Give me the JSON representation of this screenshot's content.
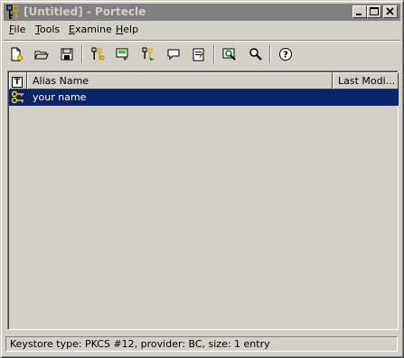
{
  "window": {
    "title": "[Untitled] - Portecle",
    "minimize_icon": "minimize-icon",
    "maximize_icon": "maximize-icon",
    "close_icon": "close-icon"
  },
  "menu": {
    "items": [
      {
        "label": "File",
        "mnemonic": "F",
        "rest": "ile"
      },
      {
        "label": "Tools",
        "mnemonic": "T",
        "rest": "ools"
      },
      {
        "label": "Examine",
        "mnemonic": "E",
        "rest": "xamine"
      },
      {
        "label": "Help",
        "mnemonic": "H",
        "rest": "elp"
      }
    ]
  },
  "toolbar": {
    "icons": [
      "new-keystore-icon",
      "open-keystore-icon",
      "save-keystore-icon",
      "generate-keypair-icon",
      "import-trusted-cert-icon",
      "import-keypair-icon",
      "set-password-icon",
      "keystore-report-icon",
      "examine-cert-icon",
      "examine-ssl-icon",
      "help-icon"
    ]
  },
  "table": {
    "columns": {
      "type": "T",
      "alias": "Alias Name",
      "modified": "Last Modi..."
    },
    "rows": [
      {
        "type_icon": "key-pair-icon",
        "alias": "your name",
        "modified": ""
      }
    ]
  },
  "status": {
    "text": "Keystore type: PKCS #12, provider: BC, size: 1 entry"
  },
  "colors": {
    "face": "#d4d0c8",
    "titlebar_inactive": "#808080",
    "selection": "#0a246a"
  }
}
